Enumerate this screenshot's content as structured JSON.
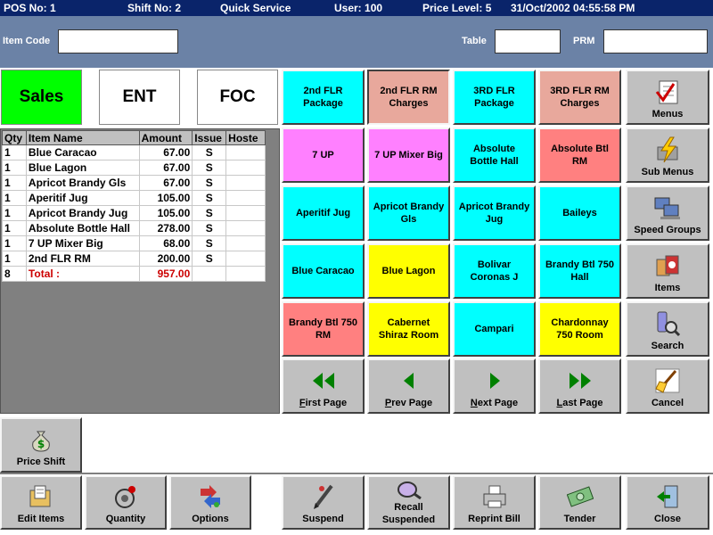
{
  "status": {
    "pos": "POS No: 1",
    "shift": "Shift No: 2",
    "mode": "Quick Service",
    "user": "User: 100",
    "price_level": "Price Level: 5",
    "datetime": "31/Oct/2002 04:55:58 PM"
  },
  "inputs": {
    "item_code_label": "Item Code",
    "item_code_value": "",
    "table_label": "Table",
    "table_value": "",
    "prm_label": "PRM",
    "prm_value": ""
  },
  "tabs": {
    "sales": "Sales",
    "ent": "ENT",
    "foc": "FOC"
  },
  "colors": {
    "sales_active": "#00ff00",
    "cyan": "#00ffff",
    "pink": "#ff80ff",
    "salmon": "#ff8080",
    "yellow": "#ffff00",
    "light_salmon": "#e8a89c"
  },
  "order": {
    "columns": [
      "Qty",
      "Item Name",
      "Amount",
      "Issue",
      "Hoste"
    ],
    "rows": [
      {
        "qty": "1",
        "name": "Blue Caracao",
        "amount": "67.00",
        "issue": "S",
        "hoste": ""
      },
      {
        "qty": "1",
        "name": "Blue Lagon",
        "amount": "67.00",
        "issue": "S",
        "hoste": ""
      },
      {
        "qty": "1",
        "name": "Apricot Brandy Gls",
        "amount": "67.00",
        "issue": "S",
        "hoste": ""
      },
      {
        "qty": "1",
        "name": "Aperitif Jug",
        "amount": "105.00",
        "issue": "S",
        "hoste": ""
      },
      {
        "qty": "1",
        "name": "Apricot Brandy Jug",
        "amount": "105.00",
        "issue": "S",
        "hoste": ""
      },
      {
        "qty": "1",
        "name": "Absolute Bottle Hall",
        "amount": "278.00",
        "issue": "S",
        "hoste": ""
      },
      {
        "qty": "1",
        "name": "7 UP Mixer Big",
        "amount": "68.00",
        "issue": "S",
        "hoste": ""
      },
      {
        "qty": "1",
        "name": "2nd FLR RM",
        "amount": "200.00",
        "issue": "S",
        "hoste": ""
      }
    ],
    "total": {
      "qty": "8",
      "label": "Total  :",
      "amount": "957.00"
    }
  },
  "items": [
    {
      "label": "2nd FLR Package",
      "color": "cyan"
    },
    {
      "label": "2nd FLR RM Charges",
      "color": "light_salmon",
      "pressed": true
    },
    {
      "label": "3RD FLR Package",
      "color": "cyan"
    },
    {
      "label": "3RD FLR RM Charges",
      "color": "light_salmon"
    },
    {
      "label": "7 UP",
      "color": "pink"
    },
    {
      "label": "7 UP Mixer Big",
      "color": "pink"
    },
    {
      "label": "Absolute Bottle Hall",
      "color": "cyan"
    },
    {
      "label": "Absolute Btl RM",
      "color": "salmon"
    },
    {
      "label": "Aperitif Jug",
      "color": "cyan"
    },
    {
      "label": "Apricot Brandy Gls",
      "color": "cyan"
    },
    {
      "label": "Apricot Brandy Jug",
      "color": "cyan"
    },
    {
      "label": "Baileys",
      "color": "cyan"
    },
    {
      "label": "Blue Caracao",
      "color": "cyan"
    },
    {
      "label": "Blue Lagon",
      "color": "yellow"
    },
    {
      "label": "Bolivar Coronas J",
      "color": "cyan"
    },
    {
      "label": "Brandy Btl 750 Hall",
      "color": "cyan"
    },
    {
      "label": "Brandy Btl 750 RM",
      "color": "salmon"
    },
    {
      "label": "Cabernet Shiraz Room",
      "color": "yellow"
    },
    {
      "label": "Campari",
      "color": "cyan"
    },
    {
      "label": "Chardonnay 750 Room",
      "color": "yellow"
    }
  ],
  "nav": {
    "first": {
      "pre": "",
      "key": "F",
      "post": "irst Page"
    },
    "prev": {
      "pre": "",
      "key": "P",
      "post": "rev Page"
    },
    "next": {
      "pre": "",
      "key": "N",
      "post": "ext Page"
    },
    "last": {
      "pre": "",
      "key": "L",
      "post": "ast Page"
    }
  },
  "side": {
    "menus": "Menus",
    "sub_menus": "Sub Menus",
    "speed_groups": "Speed Groups",
    "items": "Items",
    "search": "Search",
    "cancel": "Cancel"
  },
  "price_shift": "Price Shift",
  "bottom": {
    "edit_items": "Edit Items",
    "quantity": "Quantity",
    "options": "Options",
    "suspend": "Suspend",
    "recall_1": "Recall",
    "recall_2": "Suspended",
    "reprint": "Reprint Bill",
    "tender": "Tender",
    "close": "Close"
  }
}
